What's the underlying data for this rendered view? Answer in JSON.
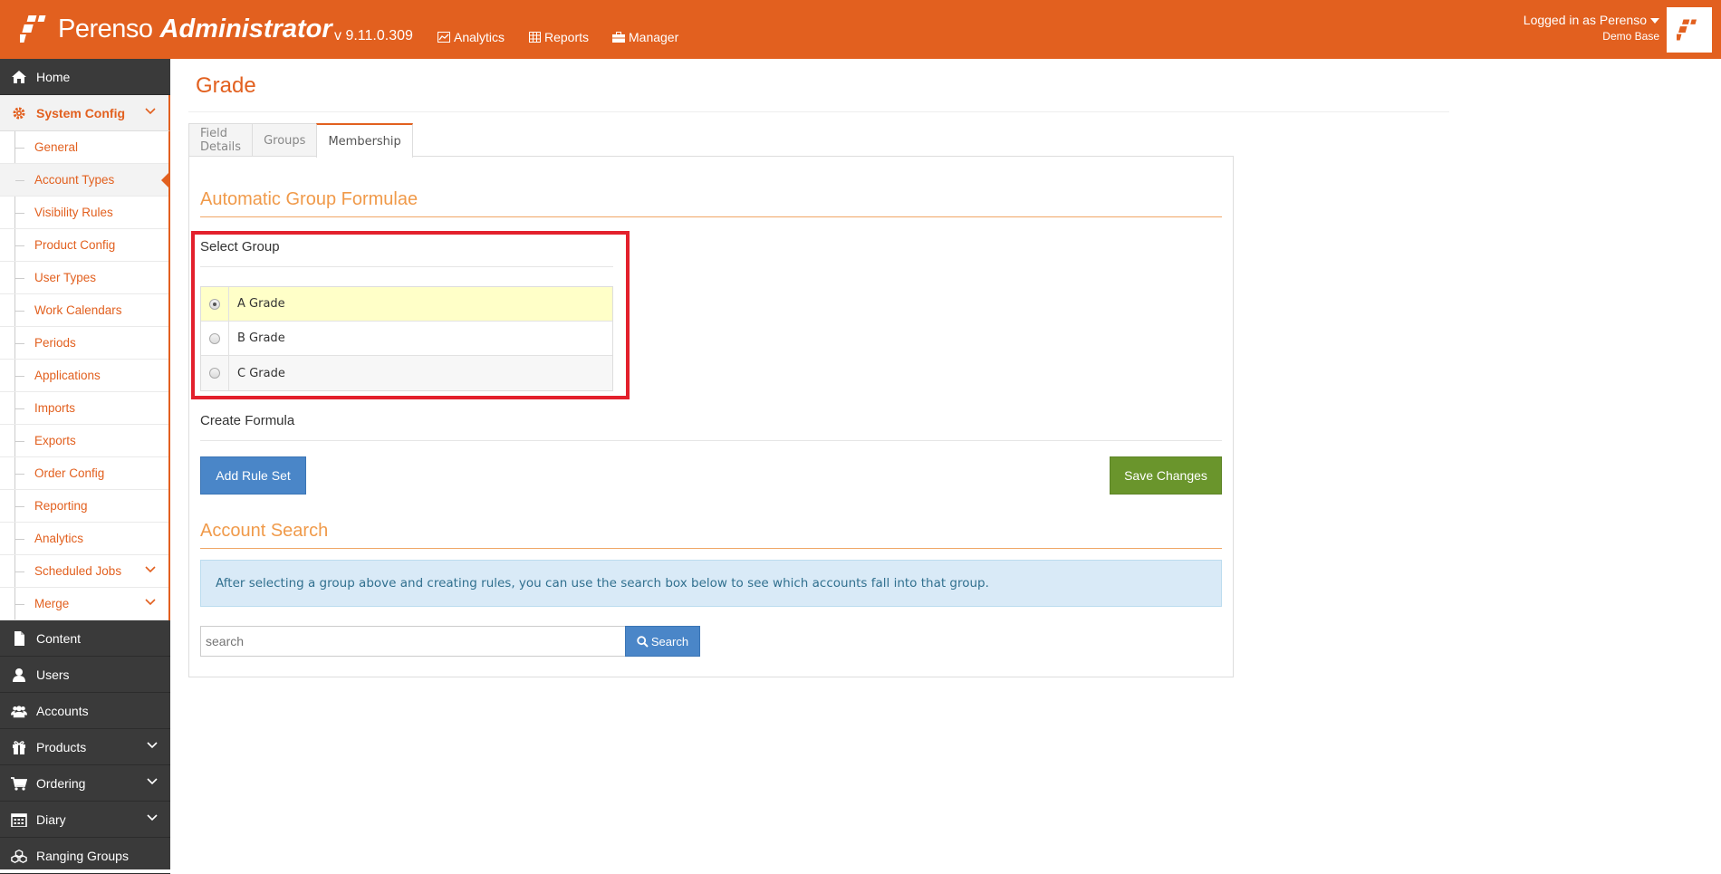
{
  "header": {
    "brand": "Perenso",
    "brand_suffix": "Administrator",
    "version": "v 9.11.0.309",
    "nav": [
      {
        "label": "Analytics",
        "icon": "chart-icon"
      },
      {
        "label": "Reports",
        "icon": "table-icon"
      },
      {
        "label": "Manager",
        "icon": "briefcase-icon"
      }
    ],
    "login_text": "Logged in as Perenso",
    "login_sub": "Demo Base"
  },
  "sidebar": {
    "top_items": [
      {
        "label": "Home",
        "icon": "home-icon"
      },
      {
        "label": "System Config",
        "icon": "gear-icon"
      }
    ],
    "sub_items": [
      {
        "label": "General"
      },
      {
        "label": "Account Types"
      },
      {
        "label": "Visibility Rules"
      },
      {
        "label": "Product Config"
      },
      {
        "label": "User Types"
      },
      {
        "label": "Work Calendars"
      },
      {
        "label": "Periods"
      },
      {
        "label": "Applications"
      },
      {
        "label": "Imports"
      },
      {
        "label": "Exports"
      },
      {
        "label": "Order Config"
      },
      {
        "label": "Reporting"
      },
      {
        "label": "Analytics"
      },
      {
        "label": "Scheduled Jobs"
      },
      {
        "label": "Merge"
      }
    ],
    "bottom_items": [
      {
        "label": "Content",
        "icon": "file-icon"
      },
      {
        "label": "Users",
        "icon": "user-icon"
      },
      {
        "label": "Accounts",
        "icon": "users-icon"
      },
      {
        "label": "Products",
        "icon": "gift-icon"
      },
      {
        "label": "Ordering",
        "icon": "cart-icon"
      },
      {
        "label": "Diary",
        "icon": "calendar-icon"
      },
      {
        "label": "Ranging Groups",
        "icon": "cubes-icon"
      }
    ]
  },
  "main": {
    "title": "Grade",
    "tabs": [
      {
        "label": "Field Details"
      },
      {
        "label": "Groups"
      },
      {
        "label": "Membership"
      }
    ],
    "formulae_heading": "Automatic Group Formulae",
    "select_group_label": "Select Group",
    "groups": [
      {
        "label": "A Grade",
        "selected": true
      },
      {
        "label": "B Grade",
        "selected": false
      },
      {
        "label": "C Grade",
        "selected": false
      }
    ],
    "create_formula_label": "Create Formula",
    "add_rule_set_label": "Add Rule Set",
    "save_changes_label": "Save Changes",
    "account_search_heading": "Account Search",
    "info_text": "After selecting a group above and creating rules, you can use the search box below to see which accounts fall into that group.",
    "search_placeholder": "search",
    "search_button_label": "Search"
  },
  "colors": {
    "brand_orange": "#e2601f",
    "highlight_red": "#e3202c",
    "button_blue": "#4a86c8",
    "button_green": "#6a952c"
  }
}
